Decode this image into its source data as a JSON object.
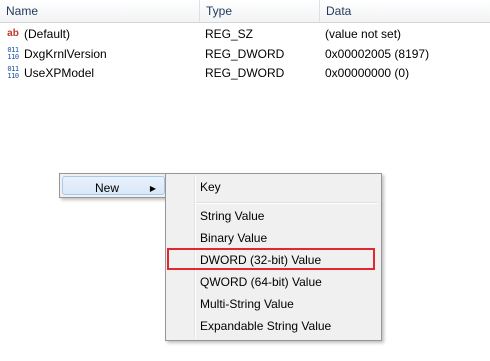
{
  "columns": {
    "name": "Name",
    "type": "Type",
    "data": "Data"
  },
  "rows": [
    {
      "icon": "string-value-icon",
      "icon_glyph": "ab",
      "name": "(Default)",
      "type": "REG_SZ",
      "data": "(value not set)"
    },
    {
      "icon": "binary-value-icon",
      "icon_glyph": "011\n110",
      "name": "DxgKrnlVersion",
      "type": "REG_DWORD",
      "data": "0x00002005 (8197)"
    },
    {
      "icon": "binary-value-icon",
      "icon_glyph": "011\n110",
      "name": "UseXPModel",
      "type": "REG_DWORD",
      "data": "0x00000000 (0)"
    }
  ],
  "context_menu": {
    "new_label": "New",
    "arrow_icon": "submenu-arrow-icon"
  },
  "new_submenu": {
    "key": "Key",
    "string_value": "String Value",
    "binary_value": "Binary Value",
    "dword_value": "DWORD (32-bit) Value",
    "qword_value": "QWORD (64-bit) Value",
    "multi_string_value": "Multi-String Value",
    "expandable_string_value": "Expandable String Value"
  },
  "colors": {
    "highlight_box": "#e0282e",
    "menu_bg": "#f0f0f0",
    "header_text": "#1e395b"
  }
}
